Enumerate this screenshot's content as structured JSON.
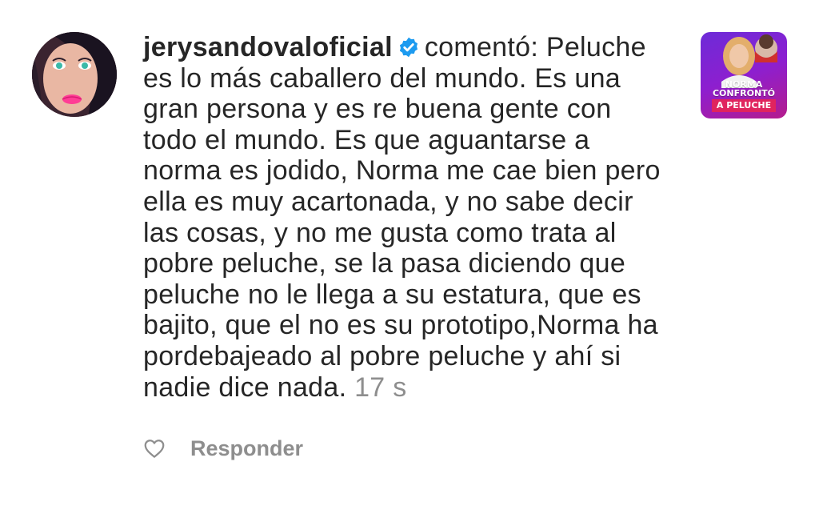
{
  "comment": {
    "username": "jerysandovaloficial",
    "verified": true,
    "action": "comentó:",
    "text": " Peluche\nes lo más caballero del mundo. Es una\ngran persona y es re buena gente con\ntodo el mundo. Es que aguantarse a\nnorma es jodido, Norma me cae bien pero\nella es muy acartonada, y no sabe decir\nlas cosas, y no me gusta como trata al\npobre peluche, se la pasa diciendo que\npeluche no le llega a su estatura, que es\nbajito, que el no es su prototipo,Norma ha\npordebajeado al pobre peluche y ahí si\nnadie dice nada.",
    "timestamp": "17 s"
  },
  "thumbnail": {
    "title": "NORMA\nCONFRONTÓ",
    "banner": "A PELUCHE"
  },
  "actions": {
    "like_icon": "heart-outline-icon",
    "reply_label": "Responder"
  },
  "colors": {
    "text": "#262626",
    "muted": "#8e8e8e",
    "verified": "#1d9bf0",
    "thumb_bg": "#8d1fcf",
    "banner": "#e0245e"
  }
}
